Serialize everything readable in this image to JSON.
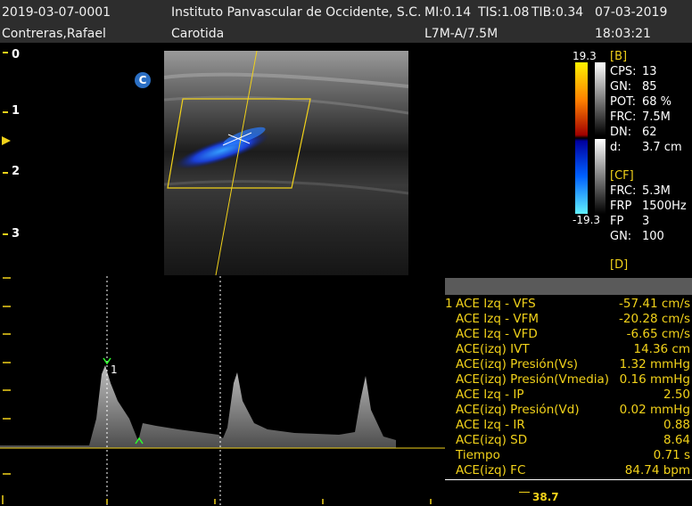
{
  "header": {
    "patient_id": "2019-03-07-0001",
    "patient_name": "Contreras,Rafael",
    "institution": "Instituto Panvascular de Occidente, S.C.",
    "mi": "MI:0.14",
    "tis": "TIS:1.08",
    "tib": "TIB:0.34",
    "date": "07-03-2019",
    "time": "18:03:21",
    "exam": "Carotida",
    "probe": "L7M-A/7.5M"
  },
  "depth_scale": [
    "0",
    "1",
    "2",
    "3"
  ],
  "color_bar": {
    "max": "19.3",
    "min": "-19.3"
  },
  "orientation_marker": "C",
  "params_b": {
    "title": "[B]",
    "rows": [
      {
        "label": "CPS:",
        "value": "13"
      },
      {
        "label": "GN:",
        "value": "85"
      },
      {
        "label": "POT:",
        "value": "68 %"
      },
      {
        "label": "FRC:",
        "value": "7.5M"
      },
      {
        "label": "DN:",
        "value": "62"
      },
      {
        "label": "d:",
        "value": "3.7 cm"
      }
    ]
  },
  "params_cf": {
    "title": "[CF]",
    "rows": [
      {
        "label": "FRC:",
        "value": "5.3M"
      },
      {
        "label": "FRP",
        "value": "1500Hz"
      },
      {
        "label": "FP",
        "value": "3"
      },
      {
        "label": "GN:",
        "value": "100"
      }
    ]
  },
  "params_d": {
    "title": "[D]"
  },
  "measurements": {
    "index": "1",
    "rows": [
      {
        "label": "ACE Izq - VFS",
        "value": "-57.41 cm/s"
      },
      {
        "label": "ACE Izq - VFM",
        "value": "-20.28 cm/s"
      },
      {
        "label": "ACE Izq - VFD",
        "value": "-6.65 cm/s"
      },
      {
        "label": "ACE(izq) IVT",
        "value": "14.36 cm"
      },
      {
        "label": "ACE(izq) Presión(Vs)",
        "value": "1.32 mmHg"
      },
      {
        "label": "ACE(izq) Presión(Vmedia)",
        "value": "0.16 mmHg"
      },
      {
        "label": "ACE Izq - IP",
        "value": "2.50"
      },
      {
        "label": "ACE(izq) Presión(Vd)",
        "value": "0.02 mmHg"
      },
      {
        "label": "ACE Izq - IR",
        "value": "0.88"
      },
      {
        "label": "ACE(izq) SD",
        "value": "8.64"
      },
      {
        "label": "Tiempo",
        "value": "0.71 s"
      },
      {
        "label": "ACE(izq) FC",
        "value": "84.74 bpm"
      }
    ]
  },
  "doppler": {
    "cursor_label": "1",
    "bottom_value": "38.7"
  }
}
